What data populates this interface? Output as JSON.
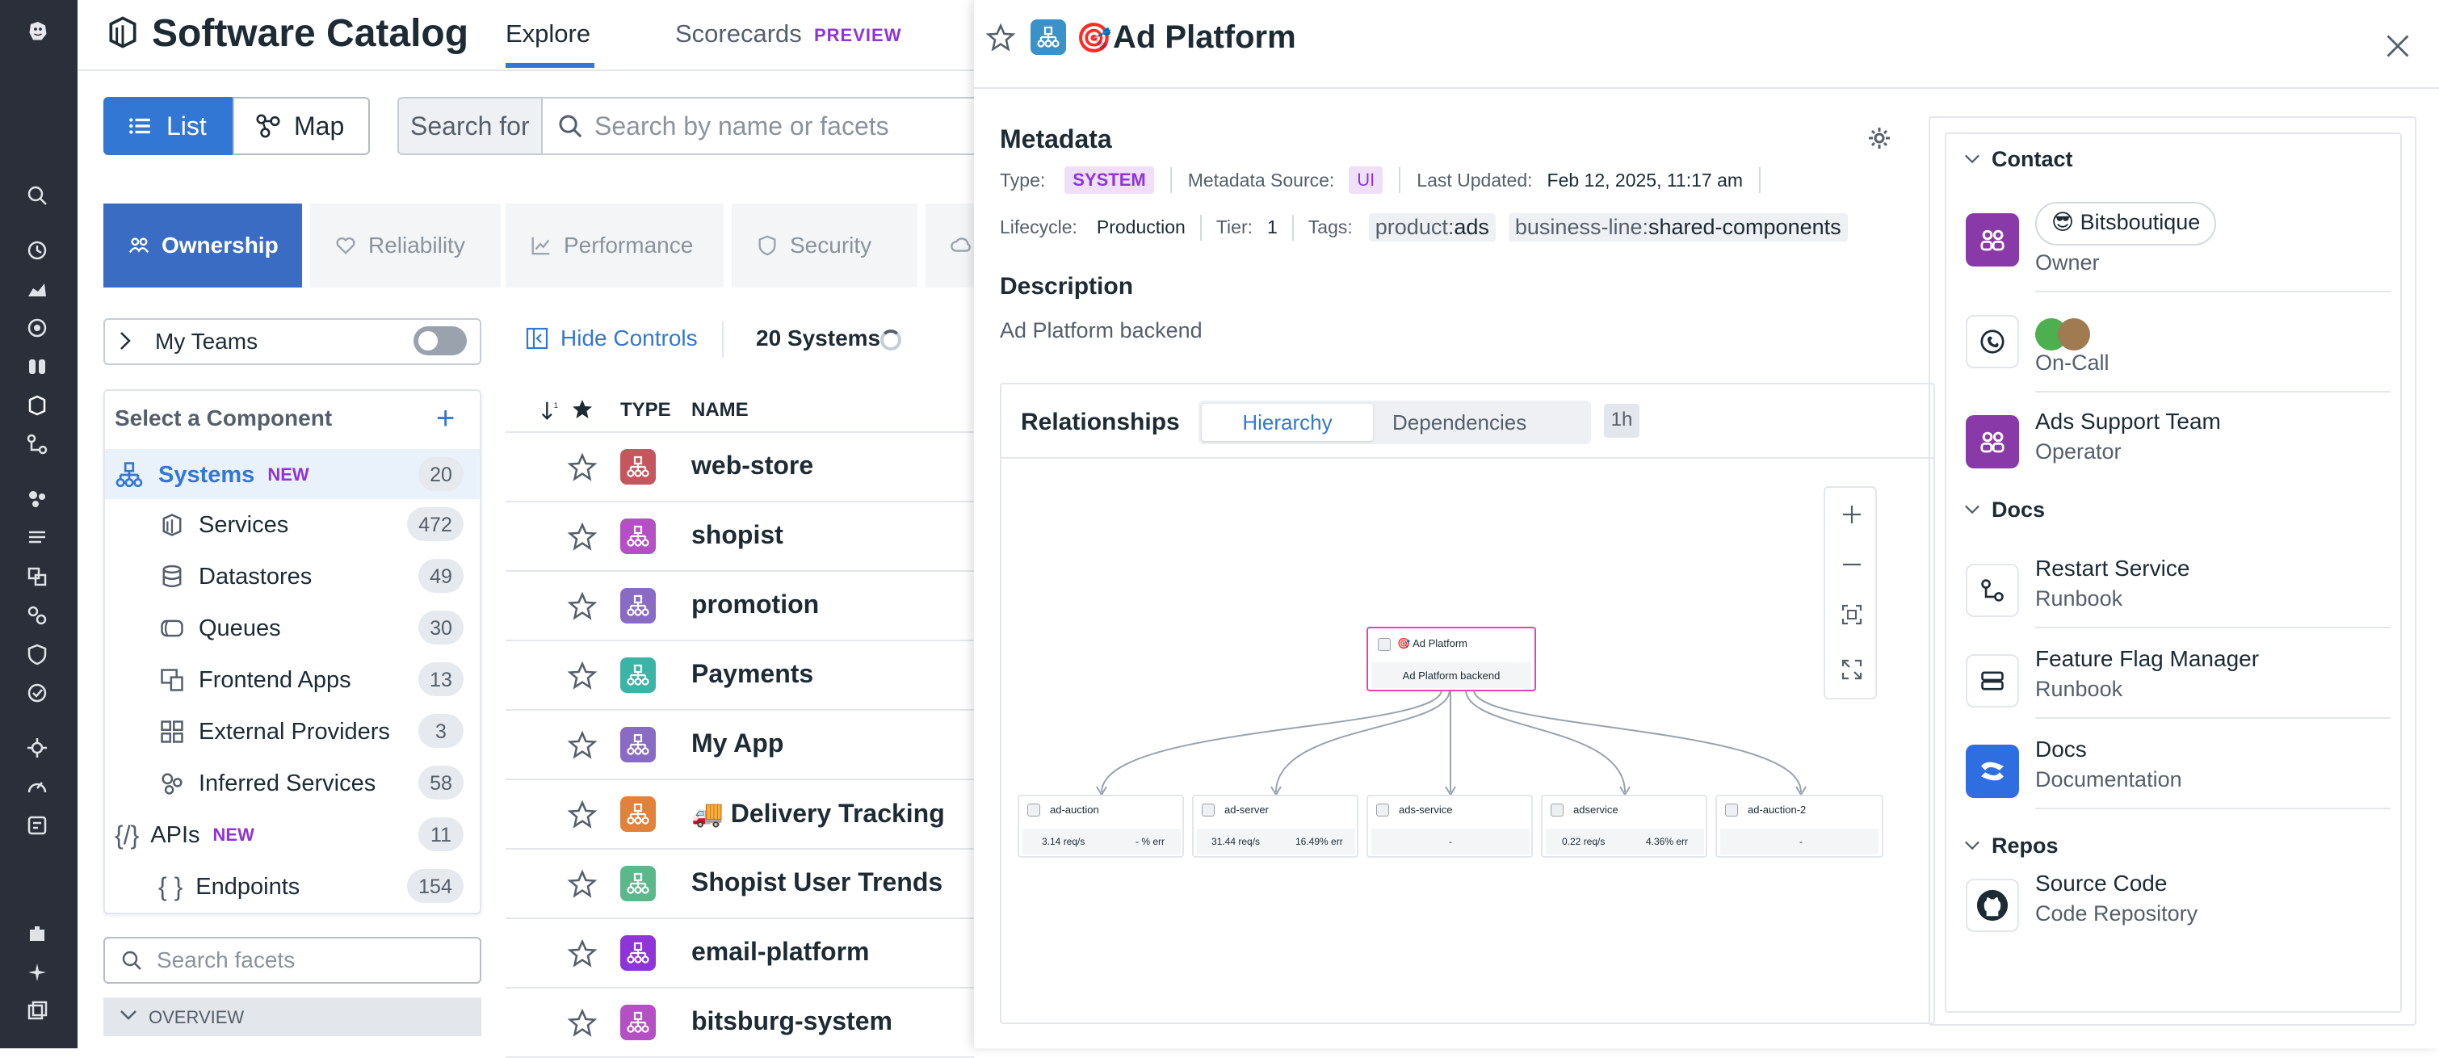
{
  "header": {
    "app_title": "Software Catalog",
    "tabs": [
      "Explore",
      "Scorecards"
    ],
    "preview_badge": "PREVIEW"
  },
  "view_toggle": {
    "list": "List",
    "map": "Map"
  },
  "search": {
    "prefix": "Search for",
    "placeholder": "Search by name or facets"
  },
  "category_tabs": [
    "Ownership",
    "Reliability",
    "Performance",
    "Security"
  ],
  "filters": {
    "my_teams": "My Teams",
    "select_component": "Select a Component",
    "components": [
      {
        "label": "Systems",
        "badge": "NEW",
        "count": "20"
      },
      {
        "label": "Services",
        "count": "472"
      },
      {
        "label": "Datastores",
        "count": "49"
      },
      {
        "label": "Queues",
        "count": "30"
      },
      {
        "label": "Frontend Apps",
        "count": "13"
      },
      {
        "label": "External Providers",
        "count": "3"
      },
      {
        "label": "Inferred Services",
        "count": "58"
      },
      {
        "label": "APIs",
        "badge": "NEW",
        "count": "11"
      },
      {
        "label": "Endpoints",
        "count": "154"
      }
    ],
    "facets_placeholder": "Search facets",
    "overview": "OVERVIEW"
  },
  "list": {
    "hide_controls": "Hide Controls",
    "count_label": "20 Systems",
    "columns": {
      "type": "TYPE",
      "name": "NAME"
    },
    "rows": [
      {
        "name": "web-store",
        "color": "#c5565e"
      },
      {
        "name": "shopist",
        "color": "#b54fc4"
      },
      {
        "name": "promotion",
        "color": "#8a6bc4"
      },
      {
        "name": "Payments",
        "color": "#3bb3a6"
      },
      {
        "name": "My App",
        "color": "#8a6bc4"
      },
      {
        "name": "🚚 Delivery Tracking",
        "color": "#e0813c"
      },
      {
        "name": "Shopist User Trends",
        "color": "#5cb88a"
      },
      {
        "name": "email-platform",
        "color": "#8f34d6"
      },
      {
        "name": "bitsburg-system",
        "color": "#b54fc4"
      }
    ]
  },
  "panel": {
    "title": "Ad Platform",
    "title_emoji": "🎯",
    "metadata_heading": "Metadata",
    "type_label": "Type:",
    "type_value": "SYSTEM",
    "source_label": "Metadata Source:",
    "source_value": "UI",
    "updated_label": "Last Updated:",
    "updated_value": "Feb 12, 2025, 11:17 am",
    "lifecycle_label": "Lifecycle:",
    "lifecycle_value": "Production",
    "tier_label": "Tier:",
    "tier_value": "1",
    "tags_label": "Tags:",
    "tags": [
      {
        "key": "product:",
        "value": "ads"
      },
      {
        "key": "business-line:",
        "value": "shared-components"
      }
    ],
    "description_heading": "Description",
    "description": "Ad Platform backend",
    "relationships": {
      "title": "Relationships",
      "tabs": [
        "Hierarchy",
        "Dependencies"
      ],
      "time": "1h",
      "root": {
        "name": "🎯 Ad Platform",
        "desc": "Ad Platform backend"
      },
      "children": [
        {
          "name": "ad-auction",
          "req": "3.14 req/s",
          "err": "- % err"
        },
        {
          "name": "ad-server",
          "req": "31.44 req/s",
          "err": "16.49% err"
        },
        {
          "name": "ads-service",
          "req": "",
          "err": "-"
        },
        {
          "name": "adservice",
          "req": "0.22 req/s",
          "err": "4.36% err"
        },
        {
          "name": "ad-auction-2",
          "req": "",
          "err": "-"
        }
      ]
    },
    "contact": {
      "contact_heading": "Contact",
      "owner_chip": "😎 Bitsboutique",
      "owner_role": "Owner",
      "oncall_role": "On-Call",
      "team_name": "Ads Support Team",
      "team_role": "Operator",
      "docs_heading": "Docs",
      "docs": [
        {
          "title": "Restart Service",
          "sub": "Runbook"
        },
        {
          "title": "Feature Flag Manager",
          "sub": "Runbook"
        },
        {
          "title": "Docs",
          "sub": "Documentation"
        }
      ],
      "repos_heading": "Repos",
      "repo_title": "Source Code",
      "repo_sub": "Code Repository"
    }
  },
  "colors": {
    "accent": "#3277d3",
    "purple": "#8f34d6",
    "nav_bg": "#2b2f3a"
  }
}
